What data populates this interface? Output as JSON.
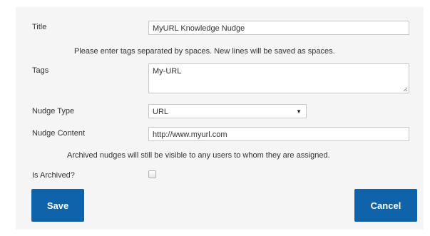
{
  "form": {
    "title": {
      "label": "Title",
      "value": "MyURL Knowledge Nudge"
    },
    "tags_hint": "Please enter tags separated by spaces. New lines will be saved as spaces.",
    "tags": {
      "label": "Tags",
      "value": "My-URL"
    },
    "nudge_type": {
      "label": "Nudge Type",
      "selected": "URL"
    },
    "nudge_content": {
      "label": "Nudge Content",
      "value": "http://www.myurl.com"
    },
    "archived_hint": "Archived nudges will still be visible to any users to whom they are assigned.",
    "is_archived": {
      "label": "Is Archived?",
      "checked": false
    }
  },
  "buttons": {
    "save_label": "Save",
    "cancel_label": "Cancel",
    "accent_color": "#0f63a8"
  },
  "icons": {
    "select_arrow": "triangle-down-icon",
    "resize": "resize-grip-icon"
  }
}
